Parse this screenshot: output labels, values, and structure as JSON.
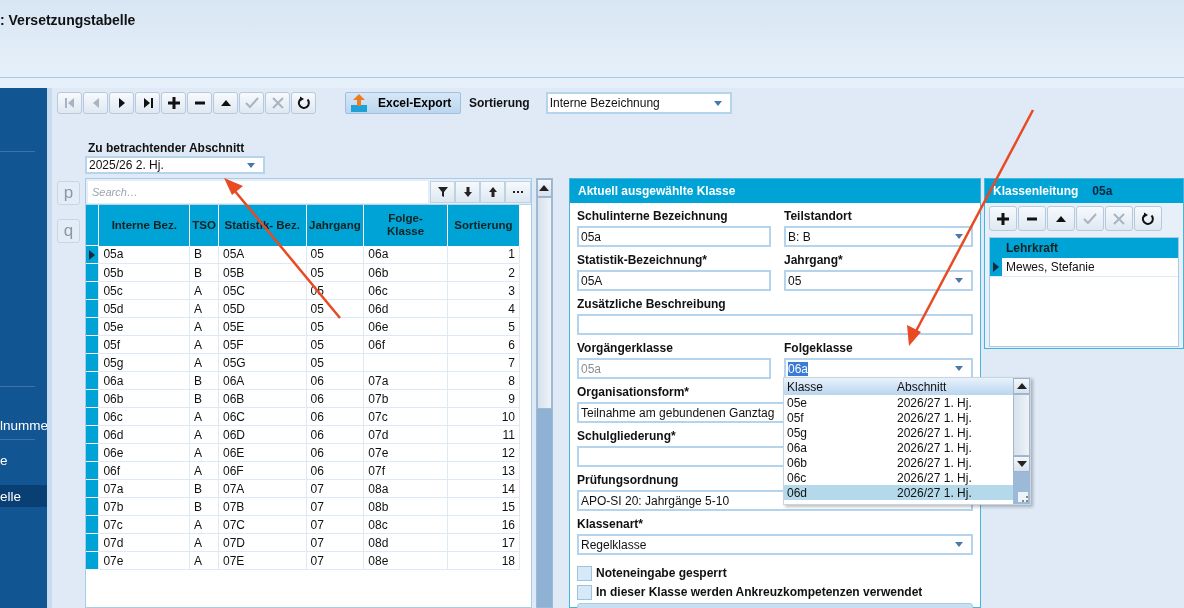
{
  "window": {
    "title": ": Versetzungstabelle"
  },
  "sidebar": {
    "items": [
      {
        "label": "lnumme",
        "selected": false
      },
      {
        "label": "e",
        "selected": false
      },
      {
        "label": "elle",
        "selected": true
      }
    ]
  },
  "toolbar": {
    "nav_buttons": [
      {
        "kind": "first",
        "disabled": true
      },
      {
        "kind": "prev",
        "disabled": true
      },
      {
        "kind": "next",
        "disabled": false
      },
      {
        "kind": "last",
        "disabled": false
      },
      {
        "kind": "add",
        "disabled": false
      },
      {
        "kind": "remove",
        "disabled": false
      },
      {
        "kind": "up",
        "disabled": false
      },
      {
        "kind": "save",
        "disabled": true
      },
      {
        "kind": "cancel",
        "disabled": true
      },
      {
        "kind": "refresh",
        "disabled": false
      }
    ],
    "export_button": "Excel-Export",
    "sort_label": "Sortierung",
    "sort_value": "Interne Bezeichnung"
  },
  "section": {
    "label": "Zu betrachtender Abschnitt",
    "value": "2025/26 2. Hj."
  },
  "side_buttons": [
    "p",
    "q"
  ],
  "search": {
    "placeholder": "Search…",
    "buttons": [
      {
        "kind": "filter"
      },
      {
        "kind": "down"
      },
      {
        "kind": "up"
      },
      {
        "kind": "more"
      }
    ]
  },
  "table": {
    "columns": [
      "Interne Bez.",
      "TSO",
      "Statistik- Bez.",
      "Jahrgang",
      "Folge- Klasse",
      "Sortierung"
    ],
    "rows": [
      {
        "cells": [
          "05a",
          "B",
          "05A",
          "05",
          "06a",
          "1"
        ],
        "selected": true
      },
      {
        "cells": [
          "05b",
          "B",
          "05B",
          "05",
          "06b",
          "2"
        ],
        "selected": false
      },
      {
        "cells": [
          "05c",
          "A",
          "05C",
          "05",
          "06c",
          "3"
        ],
        "selected": false
      },
      {
        "cells": [
          "05d",
          "A",
          "05D",
          "05",
          "06d",
          "4"
        ],
        "selected": false
      },
      {
        "cells": [
          "05e",
          "A",
          "05E",
          "05",
          "06e",
          "5"
        ],
        "selected": false
      },
      {
        "cells": [
          "05f",
          "A",
          "05F",
          "05",
          "06f",
          "6"
        ],
        "selected": false
      },
      {
        "cells": [
          "05g",
          "A",
          "05G",
          "05",
          "",
          "7"
        ],
        "selected": false
      },
      {
        "cells": [
          "06a",
          "B",
          "06A",
          "06",
          "07a",
          "8"
        ],
        "selected": false
      },
      {
        "cells": [
          "06b",
          "B",
          "06B",
          "06",
          "07b",
          "9"
        ],
        "selected": false
      },
      {
        "cells": [
          "06c",
          "A",
          "06C",
          "06",
          "07c",
          "10"
        ],
        "selected": false
      },
      {
        "cells": [
          "06d",
          "A",
          "06D",
          "06",
          "07d",
          "11"
        ],
        "selected": false
      },
      {
        "cells": [
          "06e",
          "A",
          "06E",
          "06",
          "07e",
          "12"
        ],
        "selected": false
      },
      {
        "cells": [
          "06f",
          "A",
          "06F",
          "06",
          "07f",
          "13"
        ],
        "selected": false
      },
      {
        "cells": [
          "07a",
          "B",
          "07A",
          "07",
          "08a",
          "14"
        ],
        "selected": false
      },
      {
        "cells": [
          "07b",
          "B",
          "07B",
          "07",
          "08b",
          "15"
        ],
        "selected": false
      },
      {
        "cells": [
          "07c",
          "A",
          "07C",
          "07",
          "08c",
          "16"
        ],
        "selected": false
      },
      {
        "cells": [
          "07d",
          "A",
          "07D",
          "07",
          "08d",
          "17"
        ],
        "selected": false
      },
      {
        "cells": [
          "07e",
          "A",
          "07E",
          "07",
          "08e",
          "18"
        ],
        "selected": false
      }
    ]
  },
  "detail": {
    "title": "Aktuell ausgewählte Klasse",
    "rows": [
      [
        {
          "label": "Schulinterne Bezeichnung",
          "value": "05a",
          "kind": "text"
        },
        {
          "label": "Teilstandort",
          "value": "B: B",
          "kind": "select"
        }
      ],
      [
        {
          "label": "Statistik-Bezeichnung*",
          "value": "05A",
          "kind": "text"
        },
        {
          "label": "Jahrgang*",
          "value": "05",
          "kind": "select"
        }
      ],
      [
        {
          "label": "Zusätzliche Beschreibung",
          "kind": "text"
        }
      ],
      [
        {
          "label": "Vorgängerklasse",
          "value": "05a",
          "kind": "text",
          "disabled": true
        },
        {
          "label": "Folgeklasse",
          "value": "06a",
          "kind": "select",
          "highlighted": true
        }
      ],
      [
        {
          "label": "Organisationsform*",
          "value": "Teilnahme am gebundenen Ganztag",
          "kind": "text"
        }
      ],
      [
        {
          "label": "Schulgliederung*",
          "kind": "text"
        }
      ],
      [
        {
          "label": "Prüfungsordnung",
          "value": "APO-SI 20: Jahrgänge 5-10",
          "kind": "text"
        }
      ],
      [
        {
          "label": "Klassenart*",
          "value": "Regelklasse",
          "kind": "select"
        }
      ]
    ],
    "checkboxes": [
      {
        "label": "Noteneingabe gesperrt",
        "checked": false
      },
      {
        "label": "In dieser Klasse werden Ankreuzkompetenzen verwendet",
        "checked": false
      }
    ]
  },
  "dropdown": {
    "columns": [
      "Klasse",
      "Abschnitt"
    ],
    "items": [
      {
        "klasse": "05e",
        "abschnitt": "2026/27 1. Hj.",
        "selected": false
      },
      {
        "klasse": "05f",
        "abschnitt": "2026/27 1. Hj.",
        "selected": false
      },
      {
        "klasse": "05g",
        "abschnitt": "2026/27 1. Hj.",
        "selected": false
      },
      {
        "klasse": "06a",
        "abschnitt": "2026/27 1. Hj.",
        "selected": false
      },
      {
        "klasse": "06b",
        "abschnitt": "2026/27 1. Hj.",
        "selected": false
      },
      {
        "klasse": "06c",
        "abschnitt": "2026/27 1. Hj.",
        "selected": false
      },
      {
        "klasse": "06d",
        "abschnitt": "2026/27 1. Hj.",
        "selected": true
      }
    ]
  },
  "klassenleitung": {
    "title": "Klassenleitung",
    "class_name": "05a",
    "buttons": [
      {
        "kind": "add",
        "disabled": false
      },
      {
        "kind": "remove",
        "disabled": false
      },
      {
        "kind": "up",
        "disabled": false
      },
      {
        "kind": "save",
        "disabled": true
      },
      {
        "kind": "cancel",
        "disabled": true
      },
      {
        "kind": "refresh",
        "disabled": false
      }
    ],
    "column": "Lehrkraft",
    "rows": [
      {
        "name": "Mewes, Stefanie",
        "selected": true
      }
    ]
  }
}
